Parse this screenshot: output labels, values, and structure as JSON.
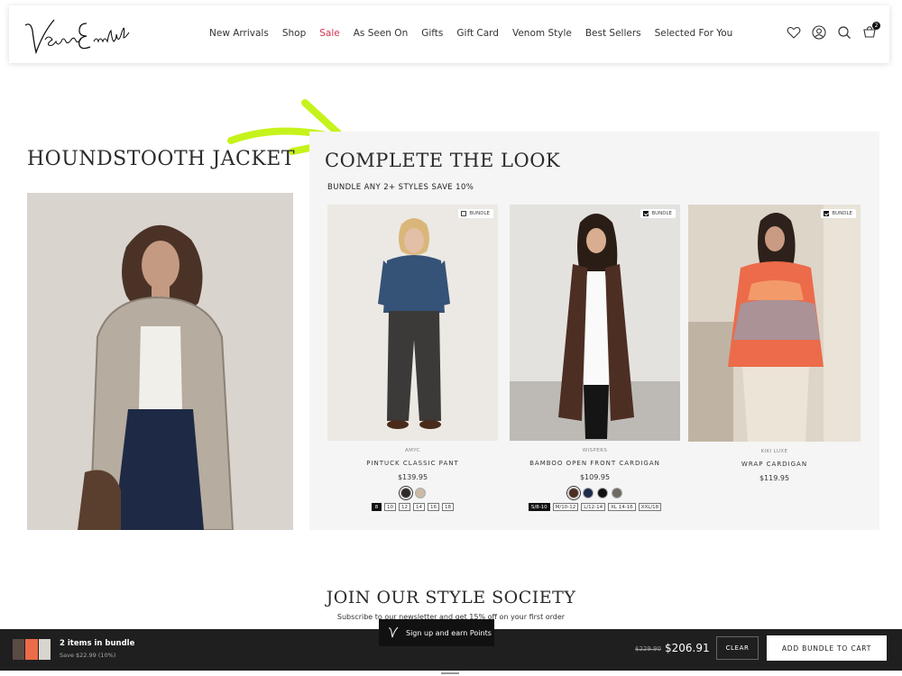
{
  "header": {
    "logo_text": "Venom Emilie",
    "nav": [
      "New Arrivals",
      "Shop",
      "Sale",
      "As Seen On",
      "Gifts",
      "Gift Card",
      "Venom Style",
      "Best Sellers",
      "Selected For You"
    ],
    "cart_count": "2",
    "icons": [
      "heart-icon",
      "account-icon",
      "search-icon",
      "cart-icon"
    ]
  },
  "product": {
    "title": "HOUNDSTOOTH JACKET"
  },
  "complete_look": {
    "title": "COMPLETE THE LOOK",
    "subtitle": "BUNDLE ANY 2+ STYLES SAVE 10%",
    "bundle_label": "BUNDLE",
    "items": [
      {
        "brand": "AMYC",
        "name": "PINTUCK CLASSIC PANT",
        "price": "$139.95",
        "bundled": false,
        "sizes": [
          "8",
          "10",
          "12",
          "14",
          "16",
          "18"
        ],
        "selected_size": "8"
      },
      {
        "brand": "WISPERS",
        "name": "BAMBOO OPEN FRONT CARDIGAN",
        "price": "$109.95",
        "bundled": true,
        "sizes": [
          "S/8-10",
          "M/10-12",
          "L/12-14",
          "XL 14-16",
          "XXL/18"
        ],
        "selected_size": "S/8-10"
      },
      {
        "brand": "KIKI LUXE",
        "name": "WRAP CARDIGAN",
        "price": "$119.95",
        "bundled": true
      }
    ]
  },
  "join": {
    "title": "JOIN OUR STYLE SOCIETY",
    "subtitle": "Subscribe to our newsletter and get 15% off on your first order"
  },
  "points": {
    "label": "Sign up and earn Points"
  },
  "bundle_bar": {
    "count": "2 items in bundle",
    "savings": "Save $22.99 (10%)",
    "old_price": "$229.90",
    "new_price": "$206.91",
    "clear": "CLEAR",
    "add": "ADD BUNDLE TO CART"
  },
  "colors": {
    "sale": "#d9334f",
    "arrow": "#c6f31b",
    "bar": "#1f1f1f"
  }
}
